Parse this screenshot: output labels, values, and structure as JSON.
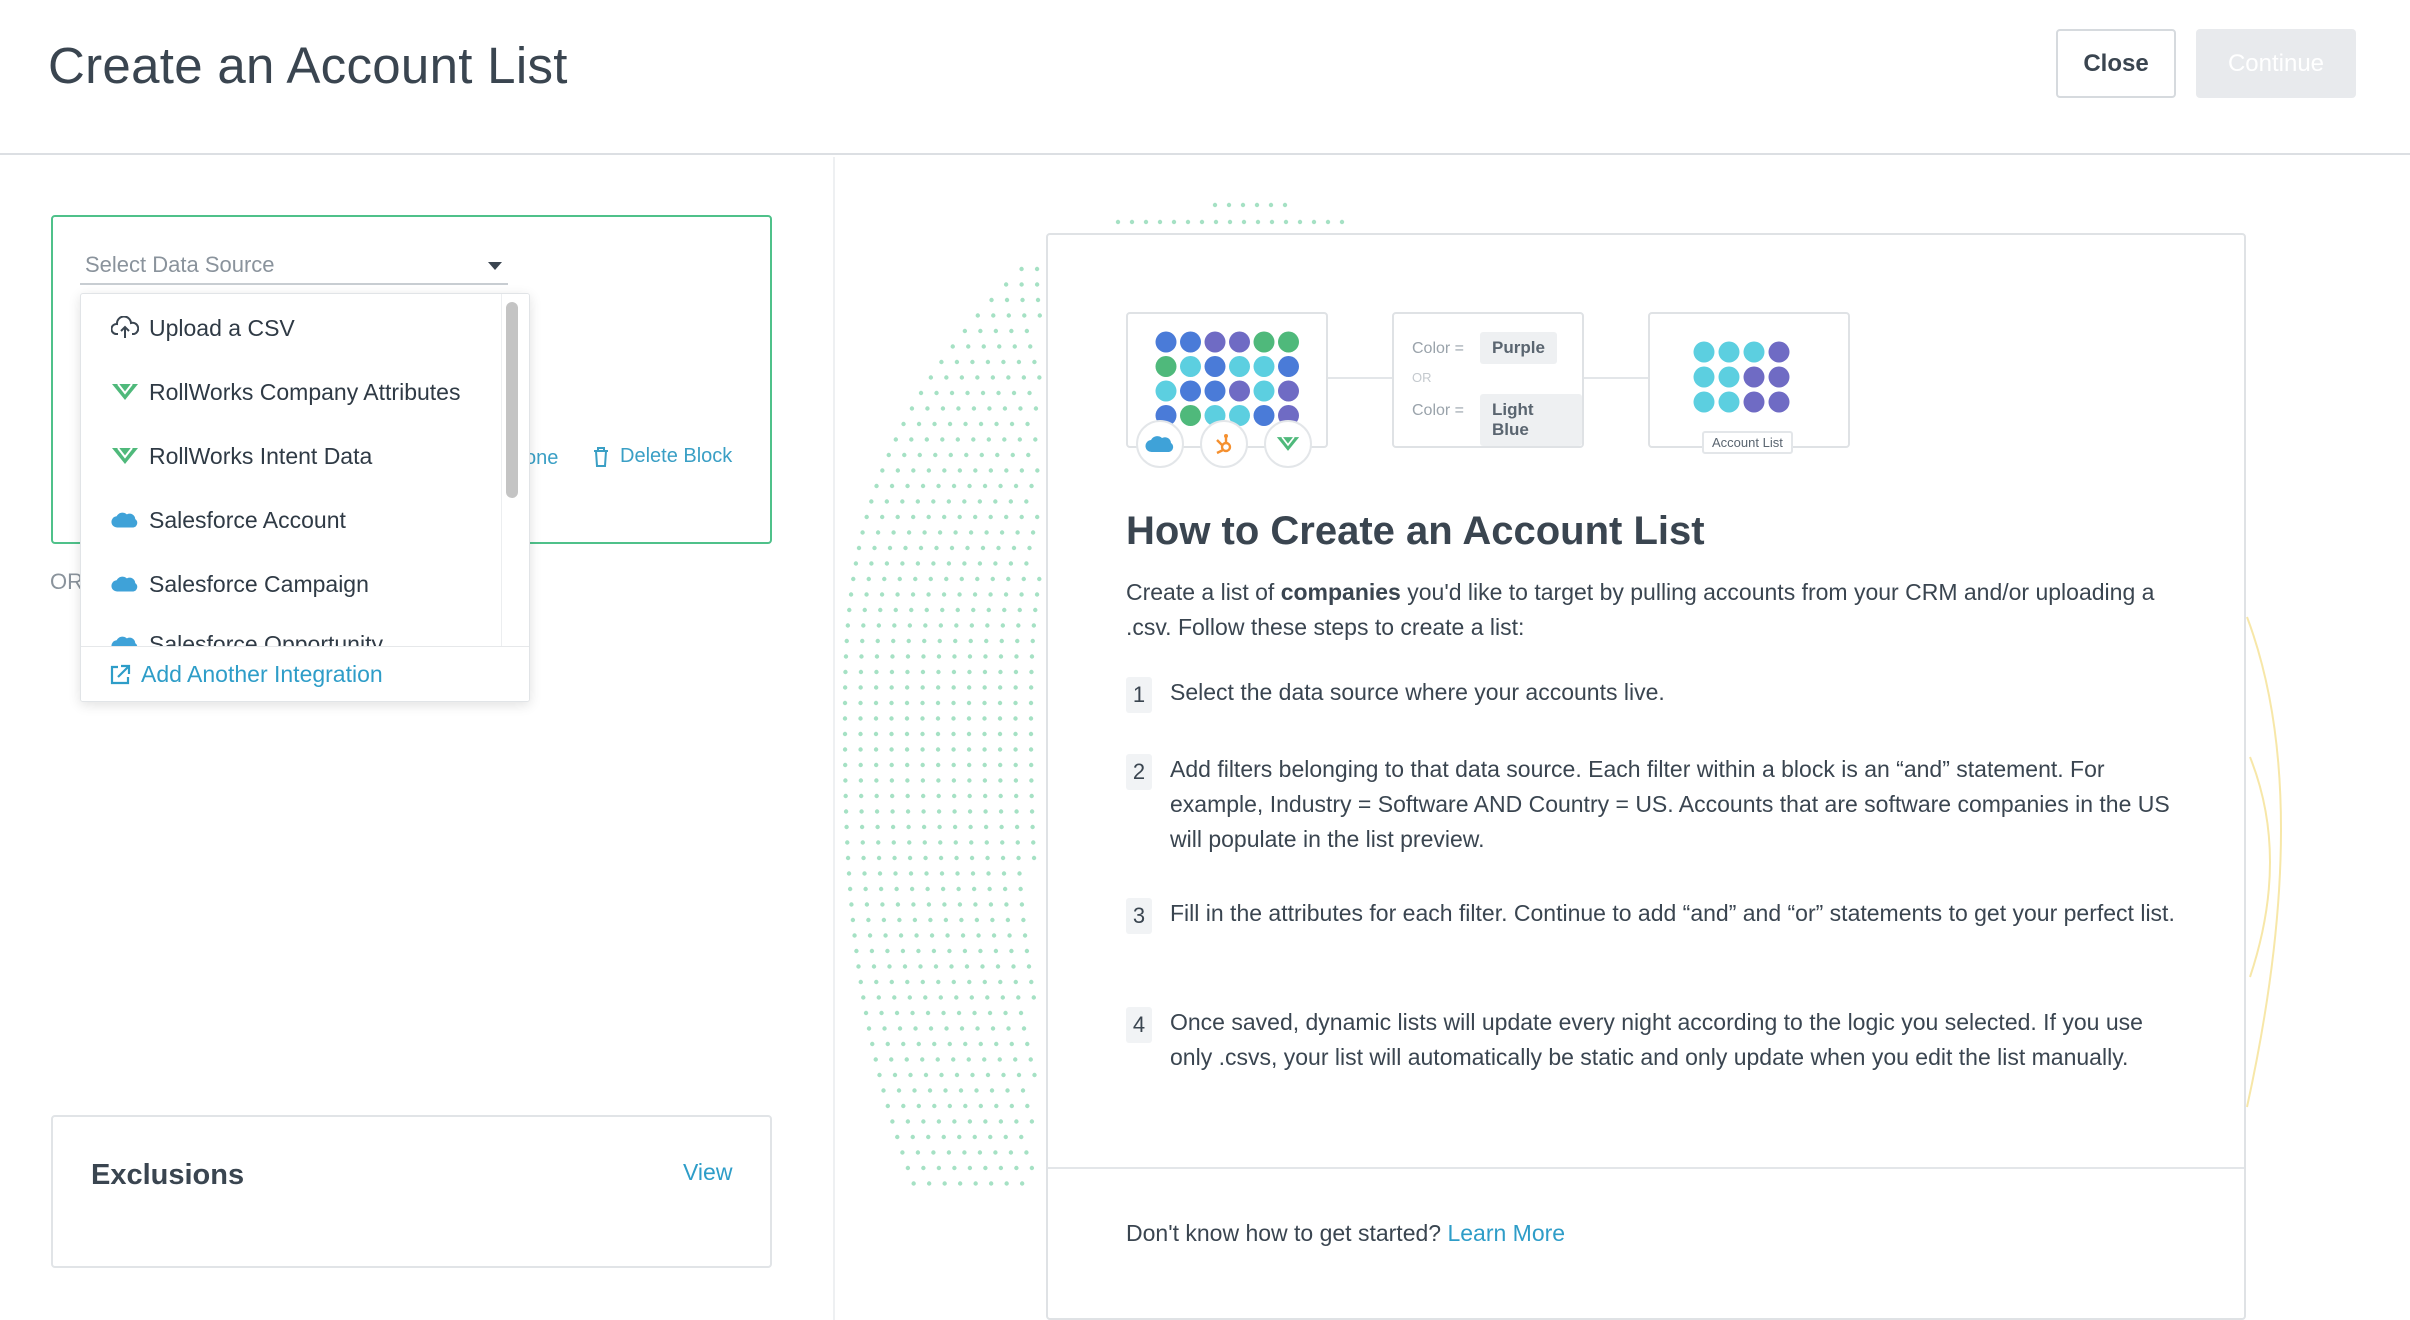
{
  "header": {
    "title": "Create an Account List",
    "close_label": "Close",
    "continue_label": "Continue"
  },
  "builder": {
    "select_placeholder": "Select Data Source",
    "clone_fragment": "one",
    "delete_block_label": "Delete Block",
    "or_label": "OR"
  },
  "dropdown": {
    "items": [
      {
        "label": "Upload a CSV",
        "icon": "upload-cloud-icon"
      },
      {
        "label": "RollWorks Company Attributes",
        "icon": "rollworks-logo-icon"
      },
      {
        "label": "RollWorks Intent Data",
        "icon": "rollworks-logo-icon"
      },
      {
        "label": "Salesforce Account",
        "icon": "salesforce-logo-icon"
      },
      {
        "label": "Salesforce Campaign",
        "icon": "salesforce-logo-icon"
      },
      {
        "label": "Salesforce Opportunity",
        "icon": "salesforce-logo-icon"
      }
    ],
    "add_integration_label": "Add Another Integration"
  },
  "exclusions": {
    "title": "Exclusions",
    "view_label": "View"
  },
  "illustration": {
    "color_label_1": "Color  =",
    "value_1": "Purple",
    "or_label": "OR",
    "color_label_2": "Color  =",
    "value_2": "Light Blue",
    "result_label": "Account List"
  },
  "info": {
    "title": "How to Create an Account List",
    "desc_before": "Create a list of ",
    "desc_bold": "companies",
    "desc_after": " you'd like to target by pulling accounts from your CRM and/or uploading a .csv. Follow these steps to create a list:",
    "steps": [
      {
        "num": "1",
        "text": "Select the data source where your accounts live."
      },
      {
        "num": "2",
        "text": "Add filters belonging to that data source. Each filter within a block is an “and” statement. For example, Industry = Software AND Country = US. Accounts that are software companies in the US will populate in the list preview."
      },
      {
        "num": "3",
        "text": "Fill in the attributes for each filter. Continue to add “and” and “or” statements to get your perfect list."
      },
      {
        "num": "4",
        "text": "Once saved, dynamic lists will update every night according to the logic you selected. If you use only .csvs, your list will automatically be static and only update when you edit the list manually."
      }
    ],
    "footer_text": "Don't know how to get started?",
    "footer_link": "Learn More"
  },
  "colors": {
    "accent_link": "#2e9dc8",
    "block_border": "#4fc18a",
    "dot_blue": "#4a7bd8",
    "dot_purple": "#6f6bc4",
    "dot_green": "#4fb97b",
    "dot_light_blue": "#5ccfe0"
  }
}
